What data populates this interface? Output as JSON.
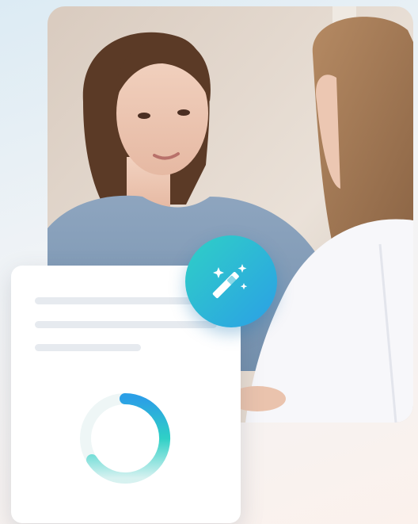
{
  "icons": {
    "magic": "magic-wand-icon",
    "spinner": "loading-ring-icon"
  },
  "colors": {
    "accent_teal": "#2fd0c6",
    "accent_blue": "#2b9fe6",
    "card_bg": "#ffffff",
    "placeholder_line": "#e6eaef"
  }
}
